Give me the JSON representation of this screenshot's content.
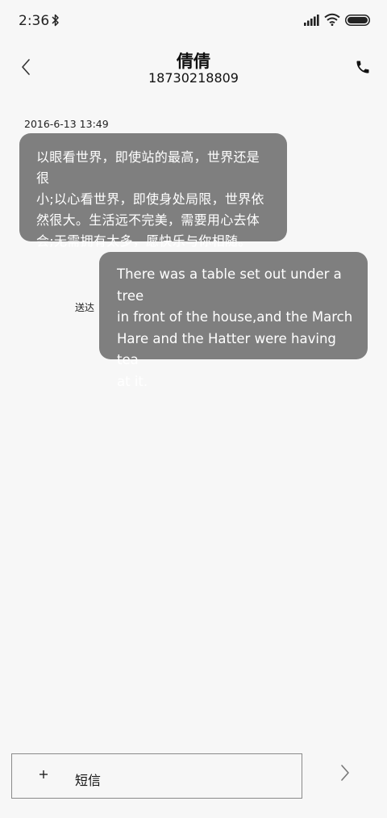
{
  "status_bar": {
    "time": "2:36",
    "icons": [
      "bluetooth-icon",
      "signal-icon",
      "wifi-icon",
      "battery-icon"
    ]
  },
  "header": {
    "contact_name": "倩倩",
    "contact_number": "18730218809",
    "icons": [
      "back-arrow-icon",
      "phone-icon"
    ]
  },
  "conversation": {
    "timestamp": "2016-6-13 13:49",
    "incoming": {
      "lines": [
        "以眼看世界，即使站的最高，世界还是很",
        "小;以心看世界，即使身处局限，世界依",
        "然很大。生活远不完美，需要用心去体",
        "会;无需拥有太多，愿快乐与你相随。"
      ]
    },
    "outgoing": {
      "lines": [
        "There was a table set out under a tree",
        "in front of the house,and the March",
        "Hare and the Hatter were having tea",
        "at it."
      ],
      "status": "送达"
    }
  },
  "compose": {
    "placeholder": "短信",
    "icons": [
      "plus-icon",
      "send-arrow-icon"
    ]
  },
  "colors": {
    "background": "#f7f7f7",
    "bubble": "#7f7f7f",
    "bubble_text": "#ffffff"
  }
}
